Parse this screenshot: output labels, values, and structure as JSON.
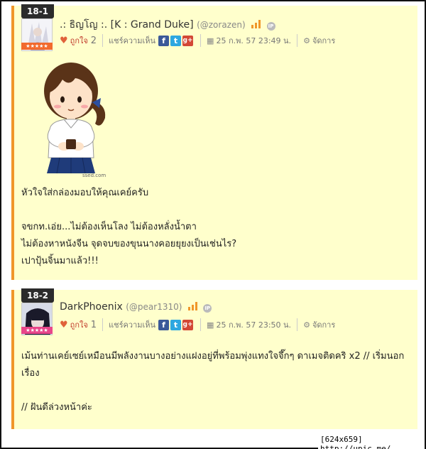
{
  "comments": [
    {
      "number": "18-1",
      "author": ".: ธิญโญ :. [K : Grand Duke]",
      "handle": "(@zorazen)",
      "stars": "★★★★★",
      "like_label": "ถูกใจ",
      "like_count": "2",
      "share_label": "แชร์ความเห็น",
      "timestamp": "25 ก.พ. 57 23:49 น.",
      "manage_label": "จัดการ",
      "image_watermark": "ssed.com",
      "paragraphs": [
        "หัวใจใส่กล่องมอบให้คุณเคย์ครับ",
        "",
        "จขกท.เอ่ย...ไม่ต้องเห็นโลง ไม่ต้องหลั่งน้ำตา",
        "ไม่ต้องหาหนังจีน จุดจบของขุนนางคอยยุยงเป็นเช่นไร?",
        "เปาปุ้นจิ้นมาแล้ว!!!"
      ]
    },
    {
      "number": "18-2",
      "author": "DarkPhoenix",
      "handle": "(@pear1310)",
      "stars": "★★★★★",
      "like_label": "ถูกใจ",
      "like_count": "1",
      "share_label": "แชร์ความเห็น",
      "timestamp": "25 ก.พ. 57 23:50 น.",
      "manage_label": "จัดการ",
      "paragraphs": [
        "เม้นท่านเคย์เซย์เหมือนมีพลังงานบางอย่างแฝงอยู่ที่พร้อมพุ่งแทงใจจึ๊กๆ ดาเมจติดคริ x2 // เริ่มนอก",
        "เรื่อง",
        "",
        "// ฝันดีล่วงหน้าค่ะ"
      ]
    }
  ],
  "icons": {
    "heart": "heart-icon",
    "facebook": "facebook-icon",
    "twitter": "twitter-icon",
    "googleplus": "googleplus-icon",
    "calendar": "calendar-icon",
    "gear": "gear-icon",
    "level": "level-icon",
    "ip": "ip-icon"
  },
  "ip_label": "IP",
  "social": {
    "facebook": "f",
    "twitter": "t",
    "googleplus": "g+"
  },
  "watermark": "[624x659] http://upic.me/",
  "colors": {
    "panel_bg": "#ffffcc",
    "accent_border": "#f0962a",
    "stars_orange": "#f26a2e",
    "stars_pink": "#e8468a"
  }
}
